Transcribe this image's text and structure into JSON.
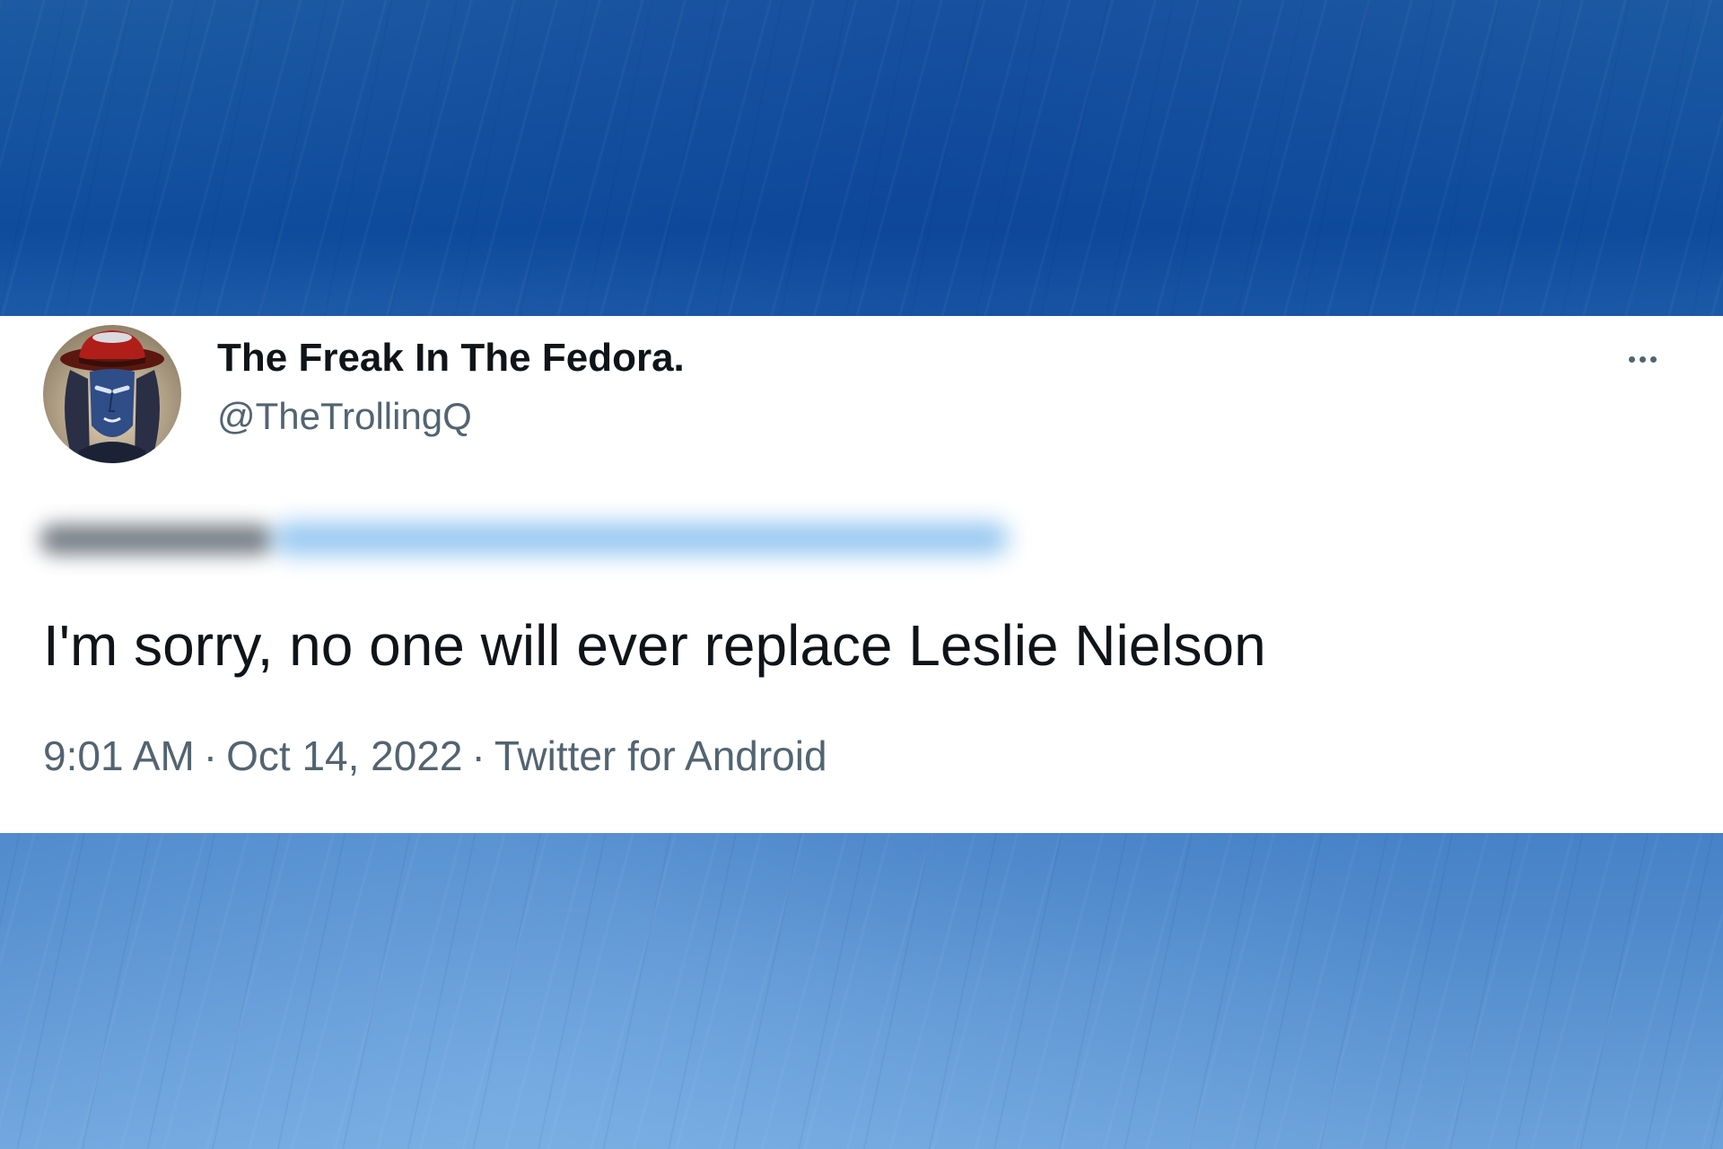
{
  "tweet": {
    "author": {
      "display_name": "The Freak In The Fedora.",
      "handle": "@TheTrollingQ",
      "avatar_icon": "fedora-character-avatar"
    },
    "text": "I'm sorry, no one will ever replace Leslie Nielson",
    "time": "9:01 AM",
    "date": "Oct 14, 2022",
    "separator": "·",
    "source": "Twitter for Android",
    "more_icon": "more-dots-icon"
  },
  "colors": {
    "card_background": "#ffffff",
    "name_text": "#0f1419",
    "secondary_text": "#536471",
    "background_blue_dark": "#0f4c9c",
    "background_blue_light": "#6ba2da",
    "blurred_link": "#3e9ae6"
  }
}
